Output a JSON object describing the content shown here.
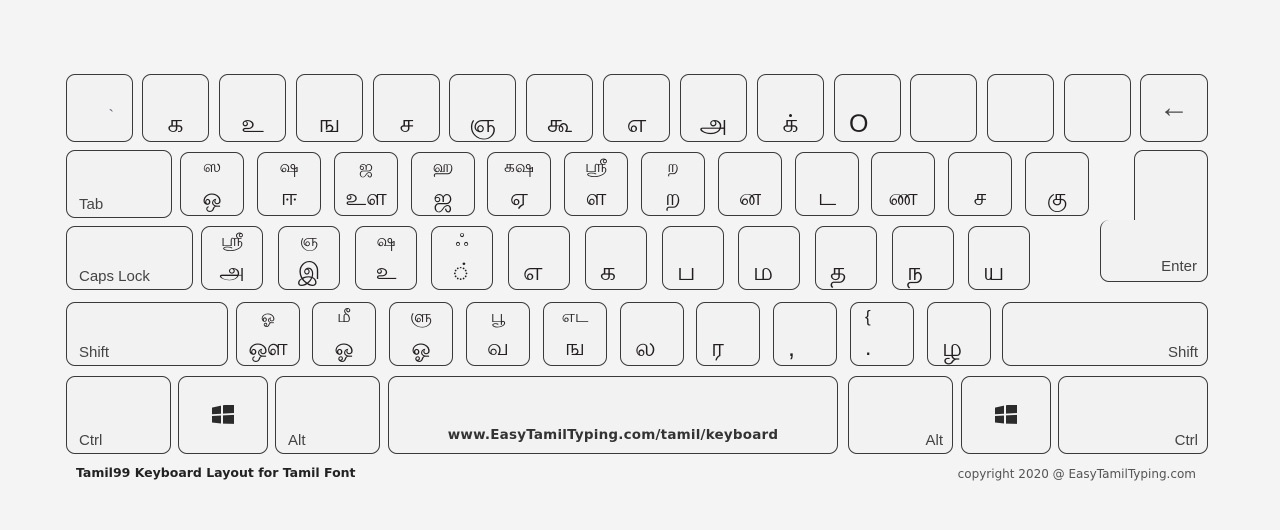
{
  "meta": {
    "title": "Tamil99 Keyboard Layout for Tamil Font",
    "copyright": "copyright 2020 @ EasyTamilTyping.com",
    "spacebar_url": "www.EasyTamilTyping.com/tamil/keyboard",
    "background_color": "#f4f4f4",
    "key_color": "#f2f2f2",
    "key_border_color": "#3a3a3a",
    "glyph_color": "#231f20"
  },
  "rows": {
    "number_row": [
      {
        "name": "backquote",
        "tick": "`"
      },
      {
        "name": "key-1",
        "main": "க"
      },
      {
        "name": "key-2",
        "main": "உ"
      },
      {
        "name": "key-3",
        "main": "ங"
      },
      {
        "name": "key-4",
        "main": "ச"
      },
      {
        "name": "key-5",
        "main": "ஞ"
      },
      {
        "name": "key-6",
        "main": "கூ"
      },
      {
        "name": "key-7",
        "main": "எ"
      },
      {
        "name": "key-8",
        "main": "அ"
      },
      {
        "name": "key-9",
        "main": "க்"
      },
      {
        "name": "key-0",
        "main": "O"
      },
      {
        "name": "minus",
        "main": ""
      },
      {
        "name": "equal",
        "main": ""
      },
      {
        "name": "extra",
        "main": ""
      },
      {
        "name": "backspace",
        "icon": "←"
      }
    ],
    "tab_row": [
      {
        "name": "tab",
        "label": "Tab"
      },
      {
        "name": "key-q",
        "top": "ஸ",
        "bottom": "ஒ"
      },
      {
        "name": "key-w",
        "top": "ஷ",
        "bottom": "ஈ"
      },
      {
        "name": "key-e",
        "top": "ஜ",
        "bottom": "உள"
      },
      {
        "name": "key-r",
        "top": "ஹ",
        "bottom": "ஜ"
      },
      {
        "name": "key-t",
        "top": "கஷ",
        "bottom": "ஏ"
      },
      {
        "name": "key-y",
        "top": "ஶ்ரீ",
        "bottom": "ள"
      },
      {
        "name": "key-u",
        "top": "ற",
        "bottom": "ற"
      },
      {
        "name": "key-i",
        "bottom": "ன"
      },
      {
        "name": "key-o",
        "bottom": "ட"
      },
      {
        "name": "key-p",
        "bottom": "ண"
      },
      {
        "name": "bracket-left",
        "bottom": "ச"
      },
      {
        "name": "bracket-right",
        "bottom": "கு"
      }
    ],
    "home_row": [
      {
        "name": "caps-lock",
        "label": "Caps Lock"
      },
      {
        "name": "key-a",
        "top": "ஶ்ரீ",
        "bottom": "அ"
      },
      {
        "name": "key-s",
        "top": "ஞ",
        "bottom": "இ"
      },
      {
        "name": "key-d",
        "top": "ஷ",
        "bottom": "உ"
      },
      {
        "name": "key-f",
        "top": "ஃ",
        "bottom": "்"
      },
      {
        "name": "key-g",
        "main": "எ"
      },
      {
        "name": "key-h",
        "main": "க"
      },
      {
        "name": "key-j",
        "main": "ப"
      },
      {
        "name": "key-k",
        "main": "ம"
      },
      {
        "name": "key-l",
        "main": "த"
      },
      {
        "name": "semicolon",
        "main": "ந"
      },
      {
        "name": "quote",
        "main": "ய"
      },
      {
        "name": "enter",
        "label": "Enter"
      }
    ],
    "shift_row": [
      {
        "name": "shift-left",
        "label": "Shift"
      },
      {
        "name": "key-z",
        "top": "ஓ",
        "bottom": "ஔ"
      },
      {
        "name": "key-x",
        "top": "மீ",
        "bottom": "ஓ"
      },
      {
        "name": "key-c",
        "top": "ளு",
        "bottom": "ஓ"
      },
      {
        "name": "key-v",
        "top": "பூ",
        "bottom": "வ"
      },
      {
        "name": "key-b",
        "top": "எட",
        "bottom": "ங"
      },
      {
        "name": "key-n",
        "main": "ல"
      },
      {
        "name": "key-m",
        "main": "ர"
      },
      {
        "name": "comma",
        "main": ","
      },
      {
        "name": "period",
        "top": "{",
        "bottom": "."
      },
      {
        "name": "slash",
        "main": "ழ"
      },
      {
        "name": "shift-right",
        "label": "Shift"
      }
    ],
    "bottom_row": [
      {
        "name": "ctrl-left",
        "label": "Ctrl"
      },
      {
        "name": "win-left",
        "icon": "windows-icon"
      },
      {
        "name": "alt-left",
        "label": "Alt"
      },
      {
        "name": "space",
        "label": "www.EasyTamilTyping.com/tamil/keyboard"
      },
      {
        "name": "alt-right",
        "label": "Alt"
      },
      {
        "name": "win-right",
        "icon": "windows-icon"
      },
      {
        "name": "ctrl-right",
        "label": "Ctrl"
      }
    ]
  }
}
